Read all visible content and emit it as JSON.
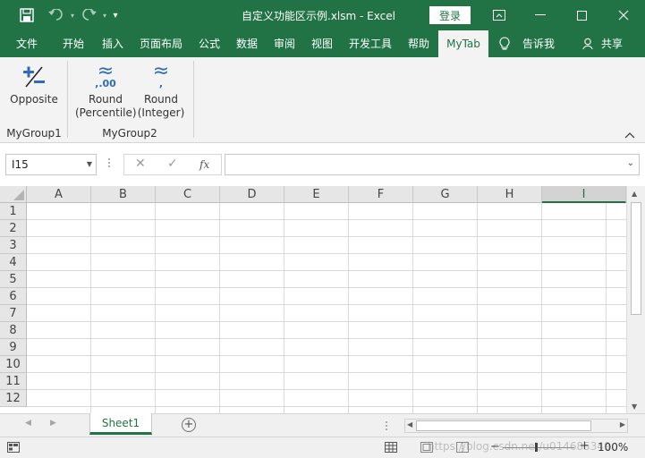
{
  "window": {
    "title": "自定义功能区示例.xlsm  -  Excel",
    "login_label": "登录",
    "qat_more": "▾"
  },
  "tabs": [
    "文件",
    "开始",
    "插入",
    "页面布局",
    "公式",
    "数据",
    "审阅",
    "视图",
    "开发工具",
    "帮助",
    "MyTab"
  ],
  "tell_me": "告诉我",
  "share": "共享",
  "ribbon": {
    "group1": {
      "label": "MyGroup1",
      "buttons": [
        {
          "label1": "Opposite",
          "label2": ""
        }
      ]
    },
    "group2": {
      "label": "MyGroup2",
      "buttons": [
        {
          "label1": "Round",
          "label2": "(Percentile)",
          "icon_text": "≈",
          "icon_sub": ",.00"
        },
        {
          "label1": "Round",
          "label2": "(Integer)",
          "icon_text": "≈",
          "icon_sub": ","
        }
      ]
    }
  },
  "formula_bar": {
    "name_box": "I15",
    "fx": "fx",
    "cancel": "✕",
    "enter": "✓"
  },
  "columns": [
    "A",
    "B",
    "C",
    "D",
    "E",
    "F",
    "G",
    "H",
    "I"
  ],
  "selected_column": "I",
  "rows": [
    "1",
    "2",
    "3",
    "4",
    "5",
    "6",
    "7",
    "8",
    "9",
    "10",
    "11",
    "12"
  ],
  "sheets": [
    "Sheet1"
  ],
  "add_sheet": "+",
  "zoom": "100%",
  "watermark": "https://blog.csdn.net/u014685349",
  "colors": {
    "brand": "#217346",
    "ribbon_bg": "#f3f3f3",
    "icon_blue": "#2e6db5"
  }
}
